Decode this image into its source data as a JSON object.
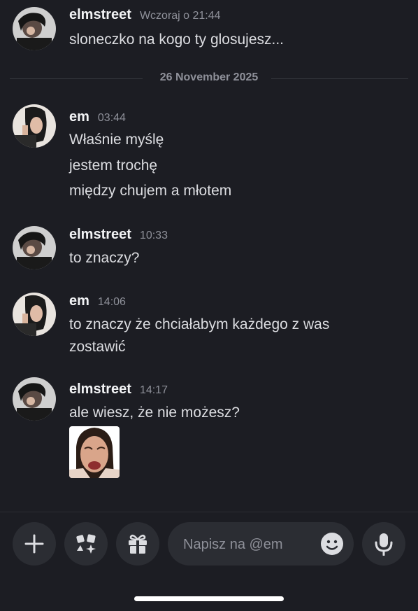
{
  "messages": [
    {
      "author": "elmstreet",
      "time": "Wczoraj o 21:44",
      "lines": [
        "sloneczko na kogo ty glosujesz..."
      ]
    },
    {
      "author": "em",
      "time": "03:44",
      "lines": [
        "Właśnie myślę",
        "jestem trochę",
        "między chujem a młotem"
      ]
    },
    {
      "author": "elmstreet",
      "time": "10:33",
      "lines": [
        "to znaczy?"
      ]
    },
    {
      "author": "em",
      "time": "14:06",
      "lines": [
        "to znaczy że chciałabym każdego z was",
        "zostawić"
      ]
    },
    {
      "author": "elmstreet",
      "time": "14:17",
      "lines": [
        "ale wiesz, że nie możesz?"
      ]
    }
  ],
  "date_divider": "26 November 2025",
  "composer": {
    "placeholder": "Napisz na @em",
    "icons": [
      "plus-icon",
      "apps-icon",
      "gift-icon",
      "emoji-icon",
      "microphone-icon"
    ]
  },
  "colors": {
    "background": "#1c1d23",
    "button_bg": "#2b2d33",
    "text": "#dcdde1",
    "muted": "#8e9099"
  }
}
